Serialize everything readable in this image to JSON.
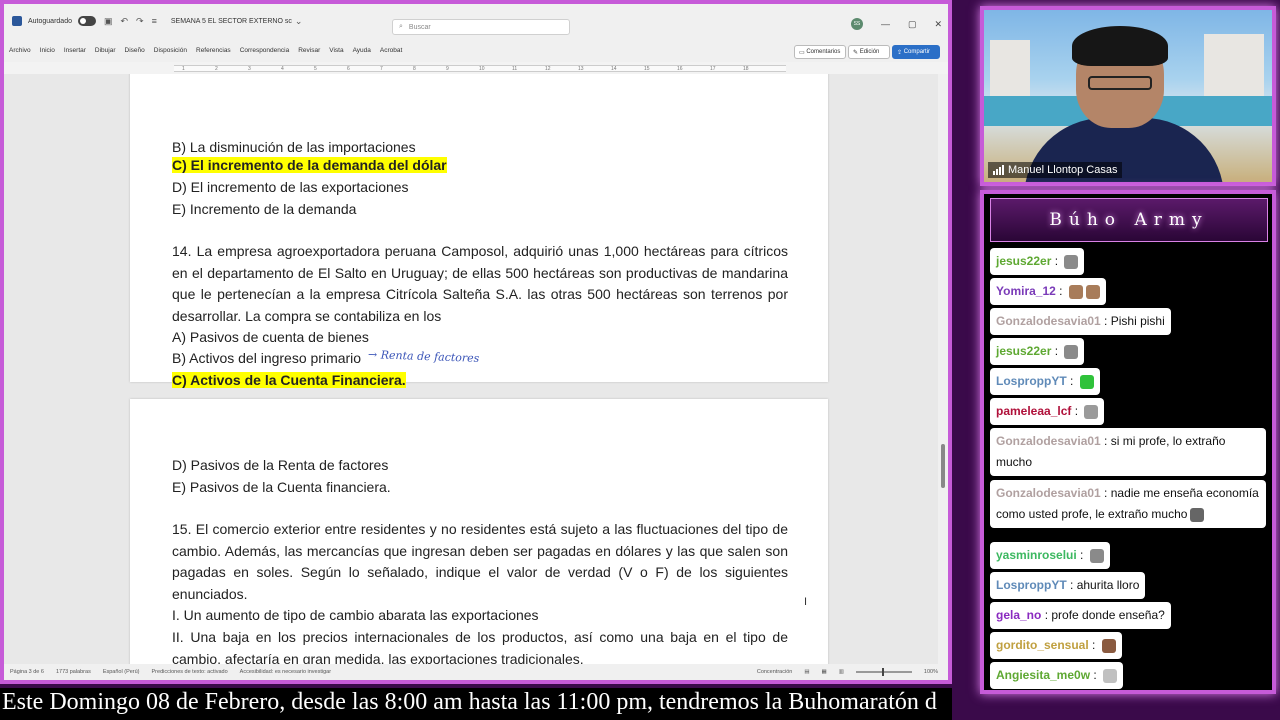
{
  "word": {
    "autosave_label": "Autoguardado",
    "doc_name": "SEMANA 5 EL SECTOR EXTERNO sc",
    "search_placeholder": "Buscar",
    "avatar_initials": "SS",
    "menu": [
      "Archivo",
      "Inicio",
      "Insertar",
      "Dibujar",
      "Diseño",
      "Disposición",
      "Referencias",
      "Correspondencia",
      "Revisar",
      "Vista",
      "Ayuda",
      "Acrobat"
    ],
    "comments_label": "Comentarios",
    "edit_label": "Edición",
    "share_label": "Compartir",
    "ruler_ticks": [
      "1",
      "2",
      "3",
      "4",
      "5",
      "6",
      "7",
      "8",
      "9",
      "10",
      "11",
      "12",
      "13",
      "14",
      "15",
      "16",
      "17",
      "18"
    ],
    "page1": {
      "cut_line": "B) La disminución de las importaciones",
      "opt_c": "C) El incremento de la demanda del dólar",
      "opt_d": "D) El incremento de las exportaciones",
      "opt_e": "E) Incremento de la demanda",
      "q14": "14. La empresa agroexportadora peruana Camposol, adquirió unas 1,000 hectáreas para cítricos en el departamento de El Salto en Uruguay; de ellas 500 hectáreas son productivas de mandarina que le pertenecían a la empresa Citrícola Salteña S.A. las otras 500 hectáreas son terrenos por desarrollar. La compra se contabiliza en los",
      "q14_a": "A) Pasivos de cuenta de bienes",
      "q14_b": "B) Activos del ingreso primario",
      "q14_c": "C) Activos de la Cuenta Financiera.",
      "handnote": "→ Renta de factores"
    },
    "page2": {
      "q14_d": "D) Pasivos de la Renta de factores",
      "q14_e": "E)  Pasivos de la Cuenta financiera.",
      "q15": "15. El comercio exterior entre residentes y no residentes está sujeto a las fluctuaciones del tipo de cambio. Además, las mercancías que ingresan deben ser pagadas en dólares y las que salen son pagadas en soles. Según lo señalado, indique el valor de verdad (V o F) de los siguientes enunciados.",
      "q15_i": "I.  Un aumento de tipo de cambio abarata las exportaciones",
      "q15_ii": "II. Una baja en los precios internacionales de los productos, así como una baja en el tipo de cambio, afectaría en gran medida, las exportaciones tradicionales."
    },
    "status": {
      "page": "Página 3 de 6",
      "words": "1773 palabras",
      "lang": "Español (Perú)",
      "predictions": "Predicciones de texto: activado",
      "accessibility": "Accesibilidad: es necesario investigar",
      "focus": "Concentración",
      "zoom": "100%"
    }
  },
  "camera": {
    "name": "Manuel Llontop Casas"
  },
  "chat": {
    "title": "Búho Army",
    "messages": [
      {
        "user": "jesus22er",
        "text": "",
        "user_color": "#5ea832",
        "emotes": [
          "#8a8a8a"
        ]
      },
      {
        "user": "Yomira_12",
        "text": "",
        "user_color": "#7a3ab8",
        "emotes": [
          "#a87c5a",
          "#a87c5a"
        ]
      },
      {
        "user": "Gonzalodesavia01",
        "text": "Pishi pishi",
        "user_color": "#b0a0a0",
        "emotes": []
      },
      {
        "user": "jesus22er",
        "text": "",
        "user_color": "#5ea832",
        "emotes": [
          "#8a8a8a"
        ]
      },
      {
        "user": "LosproppYT",
        "text": "",
        "user_color": "#5f8ab8",
        "emotes": [
          "#2fc23a"
        ]
      },
      {
        "user": "pameleaa_lcf",
        "text": "",
        "user_color": "#b0103a",
        "emotes": [
          "#9a9a9a"
        ]
      },
      {
        "user": "Gonzalodesavia01",
        "text": "si mi profe, lo extraño mucho",
        "user_color": "#b0a0a0",
        "emotes": []
      },
      {
        "user": "Gonzalodesavia01",
        "text": "nadie me enseña economía como usted profe, le extraño mucho",
        "user_color": "#b0a0a0",
        "emotes": [
          "#666"
        ]
      },
      {
        "user": "yasminroselui",
        "text": "",
        "user_color": "#3cb860",
        "emotes": [
          "#8a8a8a"
        ]
      },
      {
        "user": "LosproppYT",
        "text": "ahurita lloro",
        "user_color": "#5f8ab8",
        "emotes": []
      },
      {
        "user": "gela_no",
        "text": "profe donde enseña?",
        "user_color": "#8a2ac0",
        "emotes": []
      },
      {
        "user": "gordito_sensual",
        "text": "",
        "user_color": "#c0a040",
        "emotes": [
          "#8a5a40"
        ]
      },
      {
        "user": "Angiesita_me0w",
        "text": "",
        "user_color": "#5ea832",
        "emotes": [
          "#c0c0c0"
        ]
      }
    ]
  },
  "ticker": {
    "text": "Este Domingo 08 de Febrero, desde las 8:00 am hasta las 11:00 pm, tendremos la Buhomaratón d"
  },
  "colors": {
    "frame": "#c65bd8",
    "highlight": "#ffff00",
    "share_button": "#2b6fc7"
  }
}
